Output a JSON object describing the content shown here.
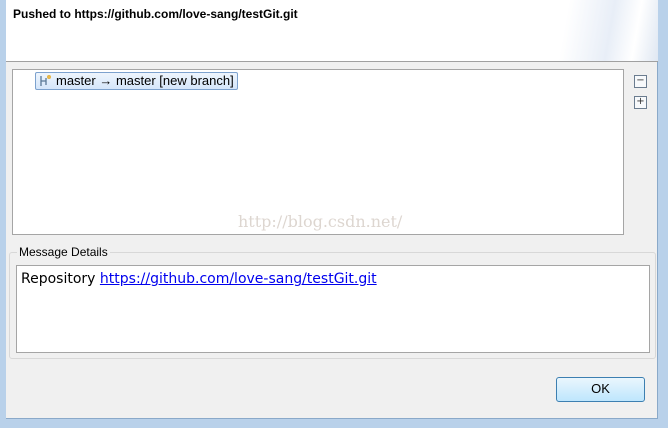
{
  "header": {
    "title": "Pushed to https://github.com/love-sang/testGit.git"
  },
  "tree": {
    "items": [
      {
        "label": "master → master [new branch]",
        "icon": "branch-push-icon"
      }
    ]
  },
  "toolbar": {
    "collapse": "−",
    "expand": "+"
  },
  "watermark": "http://blog.csdn.net/",
  "details": {
    "label": "Message Details",
    "repo_label": "Repository",
    "repo_url": "https://github.com/love-sang/testGit.git"
  },
  "buttons": {
    "ok": "OK"
  }
}
